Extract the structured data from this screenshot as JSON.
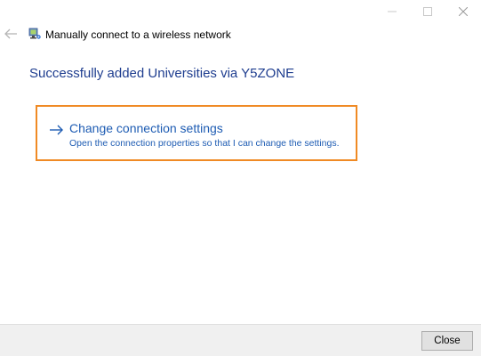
{
  "window": {
    "title": "Manually connect to a wireless network",
    "controls": [
      "minimize",
      "maximize",
      "close"
    ]
  },
  "icons": {
    "back": "back-arrow-icon",
    "network": "wireless-network-icon",
    "link_arrow": "right-arrow-icon"
  },
  "main": {
    "heading": "Successfully added Universities via Y5ZONE",
    "command_link": {
      "title": "Change connection settings",
      "description": "Open the connection properties so that I can change the settings."
    }
  },
  "footer": {
    "close_label": "Close"
  },
  "colors": {
    "heading": "#1e3d8f",
    "link": "#1e5cb3",
    "highlight": "#f08a24",
    "footer_bg": "#f0f0f0"
  }
}
